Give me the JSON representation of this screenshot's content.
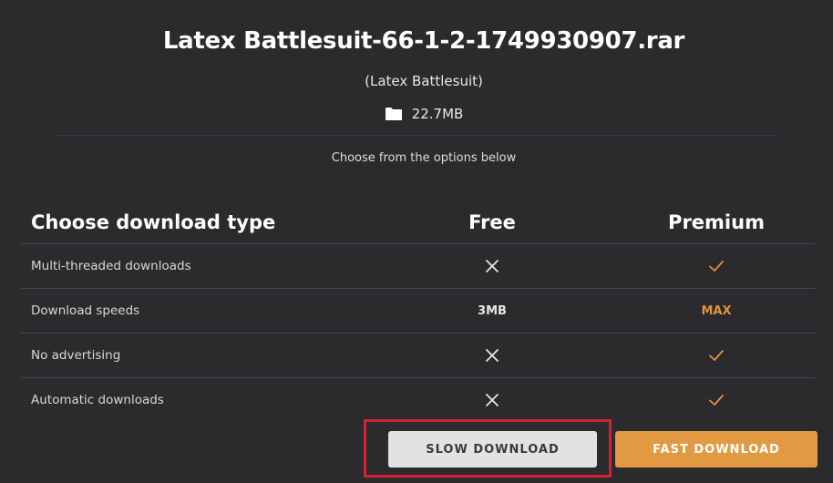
{
  "file": {
    "title": "Latex Battlesuit-66-1-2-1749930907.rar",
    "subtitle": "(Latex Battlesuit)",
    "size": "22.7MB",
    "size_icon": "folder-icon"
  },
  "prompt": "Choose from the options below",
  "table": {
    "header": {
      "label": "Choose download type",
      "free": "Free",
      "premium": "Premium"
    },
    "rows": [
      {
        "label": "Multi-threaded downloads",
        "free": "x-icon",
        "premium": "check-icon"
      },
      {
        "label": "Download speeds",
        "free": "3MB",
        "premium": "MAX"
      },
      {
        "label": "No advertising",
        "free": "x-icon",
        "premium": "check-icon"
      },
      {
        "label": "Automatic downloads",
        "free": "x-icon",
        "premium": "check-icon"
      }
    ]
  },
  "buttons": {
    "slow": "SLOW DOWNLOAD",
    "fast": "FAST DOWNLOAD"
  },
  "colors": {
    "background": "#2b2a2d",
    "accent": "#e19a41",
    "highlight": "#d42030"
  }
}
